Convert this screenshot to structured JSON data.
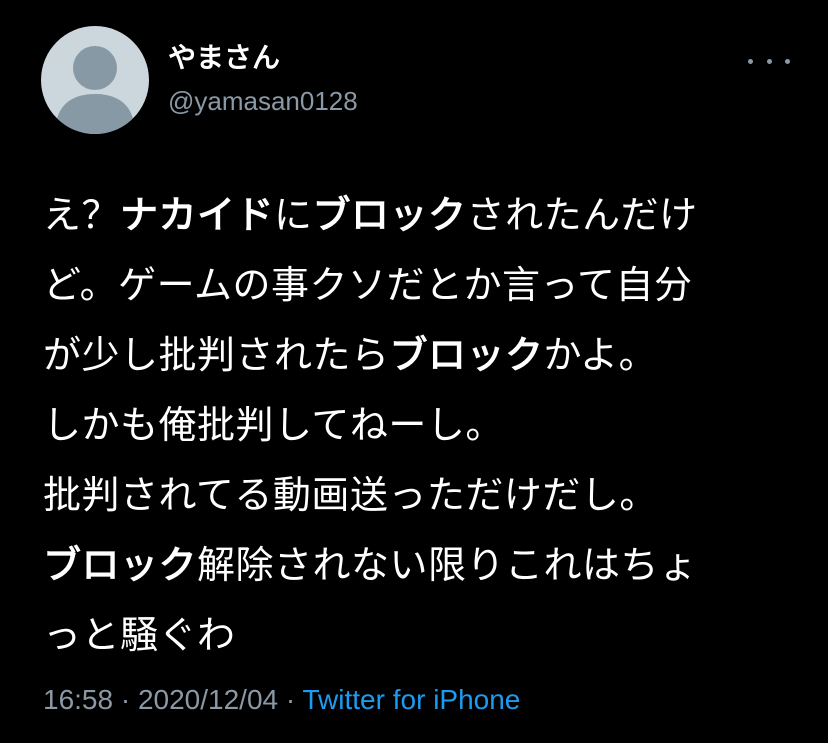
{
  "user": {
    "display_name": "やまさん",
    "handle": "@yamasan0128"
  },
  "tweet": {
    "lines": [
      [
        {
          "t": "え？",
          "b": false
        },
        {
          "t": "ナカイド",
          "b": true
        },
        {
          "t": "に",
          "b": false
        },
        {
          "t": "ブロック",
          "b": true
        },
        {
          "t": "されたんだけ",
          "b": false
        }
      ],
      [
        {
          "t": "ど。ゲームの事クソだとか言って自分",
          "b": false
        }
      ],
      [
        {
          "t": "が少し批判されたら",
          "b": false
        },
        {
          "t": "ブロック",
          "b": true
        },
        {
          "t": "かよ。",
          "b": false
        }
      ],
      [
        {
          "t": "しかも俺批判してねーし。",
          "b": false
        }
      ],
      [
        {
          "t": "批判されてる動画送っただけだし。",
          "b": false
        }
      ],
      [
        {
          "t": "ブロック",
          "b": true
        },
        {
          "t": "解除されない限りこれはちょ",
          "b": false
        }
      ],
      [
        {
          "t": "っと騒ぐわ",
          "b": false
        }
      ]
    ]
  },
  "meta": {
    "time": "16:58",
    "separator1": " · ",
    "date": "2020/12/04",
    "separator2": " · ",
    "source": "Twitter for iPhone"
  },
  "icons": {
    "avatar": "default-profile-avatar",
    "more": "more-options-icon"
  },
  "colors": {
    "background": "#000000",
    "text": "#ffffff",
    "secondary": "#8b98a5",
    "link": "#1d9bf0",
    "avatar_bg": "#ccd6dd",
    "avatar_figure": "#8899a6"
  }
}
